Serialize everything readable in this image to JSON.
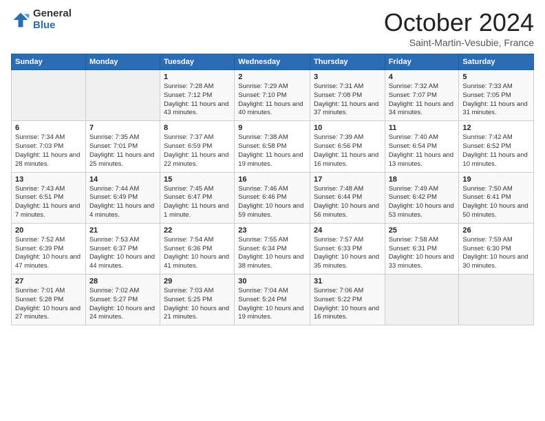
{
  "logo": {
    "general": "General",
    "blue": "Blue"
  },
  "title": {
    "month": "October 2024",
    "location": "Saint-Martin-Vesubie, France"
  },
  "headers": [
    "Sunday",
    "Monday",
    "Tuesday",
    "Wednesday",
    "Thursday",
    "Friday",
    "Saturday"
  ],
  "weeks": [
    [
      {
        "day": "",
        "sunrise": "",
        "sunset": "",
        "daylight": "",
        "empty": true
      },
      {
        "day": "",
        "sunrise": "",
        "sunset": "",
        "daylight": "",
        "empty": true
      },
      {
        "day": "1",
        "sunrise": "Sunrise: 7:28 AM",
        "sunset": "Sunset: 7:12 PM",
        "daylight": "Daylight: 11 hours and 43 minutes."
      },
      {
        "day": "2",
        "sunrise": "Sunrise: 7:29 AM",
        "sunset": "Sunset: 7:10 PM",
        "daylight": "Daylight: 11 hours and 40 minutes."
      },
      {
        "day": "3",
        "sunrise": "Sunrise: 7:31 AM",
        "sunset": "Sunset: 7:08 PM",
        "daylight": "Daylight: 11 hours and 37 minutes."
      },
      {
        "day": "4",
        "sunrise": "Sunrise: 7:32 AM",
        "sunset": "Sunset: 7:07 PM",
        "daylight": "Daylight: 11 hours and 34 minutes."
      },
      {
        "day": "5",
        "sunrise": "Sunrise: 7:33 AM",
        "sunset": "Sunset: 7:05 PM",
        "daylight": "Daylight: 11 hours and 31 minutes."
      }
    ],
    [
      {
        "day": "6",
        "sunrise": "Sunrise: 7:34 AM",
        "sunset": "Sunset: 7:03 PM",
        "daylight": "Daylight: 11 hours and 28 minutes."
      },
      {
        "day": "7",
        "sunrise": "Sunrise: 7:35 AM",
        "sunset": "Sunset: 7:01 PM",
        "daylight": "Daylight: 11 hours and 25 minutes."
      },
      {
        "day": "8",
        "sunrise": "Sunrise: 7:37 AM",
        "sunset": "Sunset: 6:59 PM",
        "daylight": "Daylight: 11 hours and 22 minutes."
      },
      {
        "day": "9",
        "sunrise": "Sunrise: 7:38 AM",
        "sunset": "Sunset: 6:58 PM",
        "daylight": "Daylight: 11 hours and 19 minutes."
      },
      {
        "day": "10",
        "sunrise": "Sunrise: 7:39 AM",
        "sunset": "Sunset: 6:56 PM",
        "daylight": "Daylight: 11 hours and 16 minutes."
      },
      {
        "day": "11",
        "sunrise": "Sunrise: 7:40 AM",
        "sunset": "Sunset: 6:54 PM",
        "daylight": "Daylight: 11 hours and 13 minutes."
      },
      {
        "day": "12",
        "sunrise": "Sunrise: 7:42 AM",
        "sunset": "Sunset: 6:52 PM",
        "daylight": "Daylight: 11 hours and 10 minutes."
      }
    ],
    [
      {
        "day": "13",
        "sunrise": "Sunrise: 7:43 AM",
        "sunset": "Sunset: 6:51 PM",
        "daylight": "Daylight: 11 hours and 7 minutes."
      },
      {
        "day": "14",
        "sunrise": "Sunrise: 7:44 AM",
        "sunset": "Sunset: 6:49 PM",
        "daylight": "Daylight: 11 hours and 4 minutes."
      },
      {
        "day": "15",
        "sunrise": "Sunrise: 7:45 AM",
        "sunset": "Sunset: 6:47 PM",
        "daylight": "Daylight: 11 hours and 1 minute."
      },
      {
        "day": "16",
        "sunrise": "Sunrise: 7:46 AM",
        "sunset": "Sunset: 6:46 PM",
        "daylight": "Daylight: 10 hours and 59 minutes."
      },
      {
        "day": "17",
        "sunrise": "Sunrise: 7:48 AM",
        "sunset": "Sunset: 6:44 PM",
        "daylight": "Daylight: 10 hours and 56 minutes."
      },
      {
        "day": "18",
        "sunrise": "Sunrise: 7:49 AM",
        "sunset": "Sunset: 6:42 PM",
        "daylight": "Daylight: 10 hours and 53 minutes."
      },
      {
        "day": "19",
        "sunrise": "Sunrise: 7:50 AM",
        "sunset": "Sunset: 6:41 PM",
        "daylight": "Daylight: 10 hours and 50 minutes."
      }
    ],
    [
      {
        "day": "20",
        "sunrise": "Sunrise: 7:52 AM",
        "sunset": "Sunset: 6:39 PM",
        "daylight": "Daylight: 10 hours and 47 minutes."
      },
      {
        "day": "21",
        "sunrise": "Sunrise: 7:53 AM",
        "sunset": "Sunset: 6:37 PM",
        "daylight": "Daylight: 10 hours and 44 minutes."
      },
      {
        "day": "22",
        "sunrise": "Sunrise: 7:54 AM",
        "sunset": "Sunset: 6:36 PM",
        "daylight": "Daylight: 10 hours and 41 minutes."
      },
      {
        "day": "23",
        "sunrise": "Sunrise: 7:55 AM",
        "sunset": "Sunset: 6:34 PM",
        "daylight": "Daylight: 10 hours and 38 minutes."
      },
      {
        "day": "24",
        "sunrise": "Sunrise: 7:57 AM",
        "sunset": "Sunset: 6:33 PM",
        "daylight": "Daylight: 10 hours and 35 minutes."
      },
      {
        "day": "25",
        "sunrise": "Sunrise: 7:58 AM",
        "sunset": "Sunset: 6:31 PM",
        "daylight": "Daylight: 10 hours and 33 minutes."
      },
      {
        "day": "26",
        "sunrise": "Sunrise: 7:59 AM",
        "sunset": "Sunset: 6:30 PM",
        "daylight": "Daylight: 10 hours and 30 minutes."
      }
    ],
    [
      {
        "day": "27",
        "sunrise": "Sunrise: 7:01 AM",
        "sunset": "Sunset: 5:28 PM",
        "daylight": "Daylight: 10 hours and 27 minutes."
      },
      {
        "day": "28",
        "sunrise": "Sunrise: 7:02 AM",
        "sunset": "Sunset: 5:27 PM",
        "daylight": "Daylight: 10 hours and 24 minutes."
      },
      {
        "day": "29",
        "sunrise": "Sunrise: 7:03 AM",
        "sunset": "Sunset: 5:25 PM",
        "daylight": "Daylight: 10 hours and 21 minutes."
      },
      {
        "day": "30",
        "sunrise": "Sunrise: 7:04 AM",
        "sunset": "Sunset: 5:24 PM",
        "daylight": "Daylight: 10 hours and 19 minutes."
      },
      {
        "day": "31",
        "sunrise": "Sunrise: 7:06 AM",
        "sunset": "Sunset: 5:22 PM",
        "daylight": "Daylight: 10 hours and 16 minutes."
      },
      {
        "day": "",
        "sunrise": "",
        "sunset": "",
        "daylight": "",
        "empty": true
      },
      {
        "day": "",
        "sunrise": "",
        "sunset": "",
        "daylight": "",
        "empty": true
      }
    ]
  ]
}
